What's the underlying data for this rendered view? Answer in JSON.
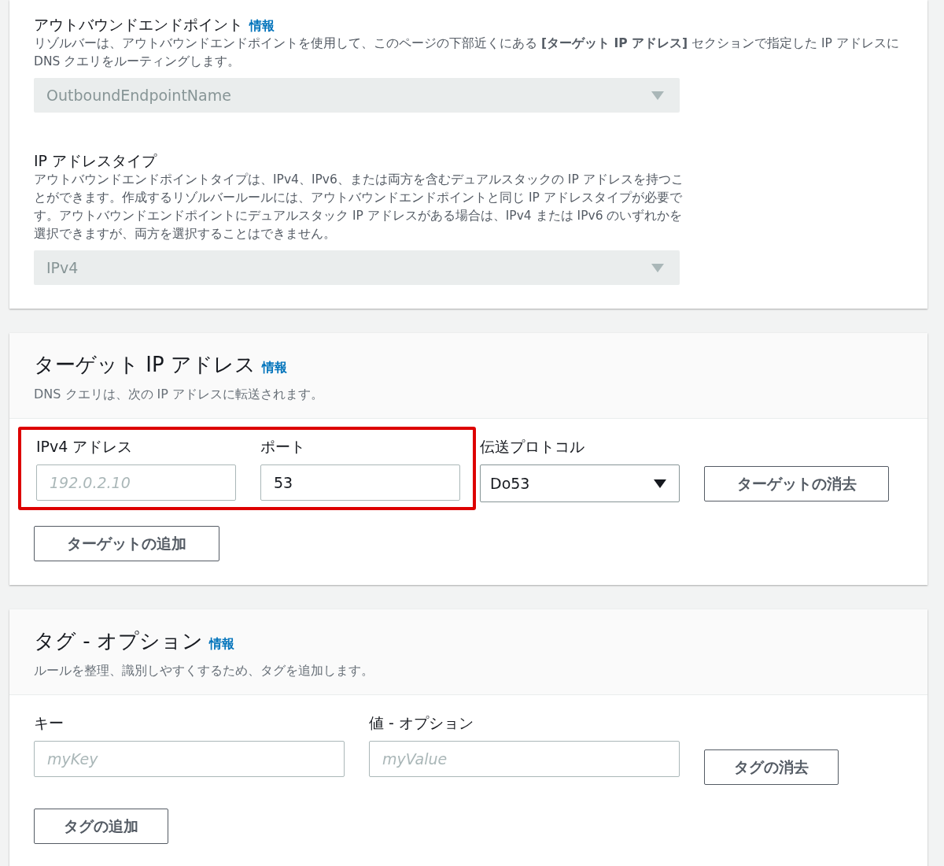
{
  "endpoint_section": {
    "outbound_endpoint": {
      "label": "アウトバウンドエンドポイント",
      "info_link": "情報",
      "description": "リゾルバーは、アウトバウンドエンドポイントを使用して、このページの下部近くにある **[ターゲット IP アドレス]** セクションで指定した IP アドレスに DNS クエリをルーティングします。",
      "value": "OutboundEndpointName",
      "disabled": true
    },
    "ip_address_type": {
      "label": "IP アドレスタイプ",
      "description": "アウトバウンドエンドポイントタイプは、IPv4、IPv6、または両方を含むデュアルスタックの IP アドレスを持つことができます。作成するリゾルバールールには、アウトバウンドエンドポイントと同じ IP アドレスタイプが必要です。アウトバウンドエンドポイントにデュアルスタック IP アドレスがある場合は、IPv4 または IPv6 のいずれかを選択できますが、両方を選択することはできません。",
      "value": "IPv4",
      "disabled": true
    }
  },
  "target_section": {
    "title": "ターゲット IP アドレス",
    "info_link": "情報",
    "description": "DNS クエリは、次の IP アドレスに転送されます。",
    "highlighted": true,
    "ipv4": {
      "label": "IPv4 アドレス",
      "placeholder": "192.0.2.10"
    },
    "port": {
      "label": "ポート",
      "value": "53"
    },
    "protocol": {
      "label": "伝送プロトコル",
      "value": "Do53"
    },
    "remove_button": "ターゲットの消去",
    "add_button": "ターゲットの追加"
  },
  "tags_section": {
    "title": "タグ - オプション",
    "info_link": "情報",
    "description": "ルールを整理、識別しやすくするため、タグを追加します。",
    "key": {
      "label": "キー",
      "placeholder": "myKey"
    },
    "value": {
      "label": "値 - オプション",
      "placeholder": "myValue"
    },
    "remove_button": "タグの消去",
    "add_button": "タグの追加"
  }
}
